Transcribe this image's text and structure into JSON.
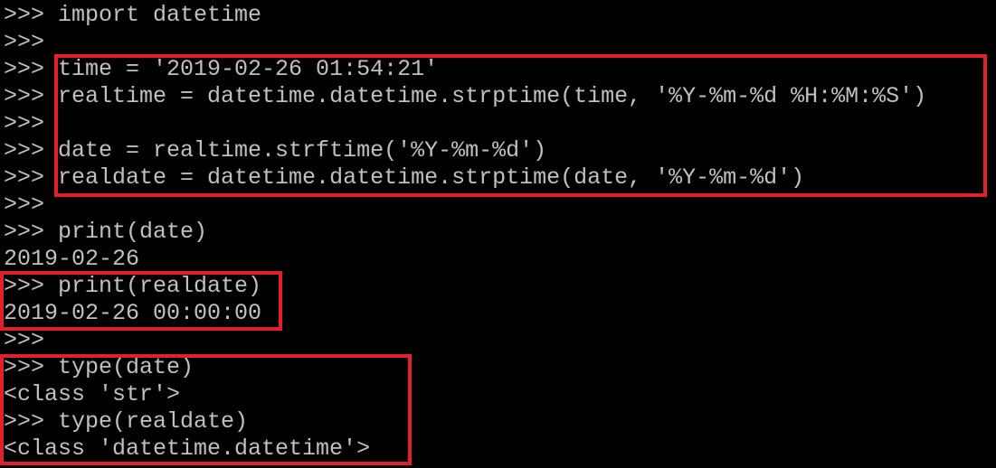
{
  "terminal": {
    "prompt": ">>> ",
    "highlight_color": "#e0212b",
    "text_color": "#c0c0c0",
    "background_color": "#000000",
    "lines": [
      {
        "kind": "input",
        "text": "import datetime"
      },
      {
        "kind": "input",
        "text": ""
      },
      {
        "kind": "input",
        "text": "time = '2019-02-26 01:54:21'"
      },
      {
        "kind": "input",
        "text": "realtime = datetime.datetime.strptime(time, '%Y-%m-%d %H:%M:%S')"
      },
      {
        "kind": "input",
        "text": ""
      },
      {
        "kind": "input",
        "text": "date = realtime.strftime('%Y-%m-%d')"
      },
      {
        "kind": "input",
        "text": "realdate = datetime.datetime.strptime(date, '%Y-%m-%d')"
      },
      {
        "kind": "input",
        "text": ""
      },
      {
        "kind": "input",
        "text": "print(date)"
      },
      {
        "kind": "output",
        "text": "2019-02-26"
      },
      {
        "kind": "input",
        "text": "print(realdate)"
      },
      {
        "kind": "output",
        "text": "2019-02-26 00:00:00"
      },
      {
        "kind": "input",
        "text": ""
      },
      {
        "kind": "input",
        "text": "type(date)"
      },
      {
        "kind": "output",
        "text": "<class 'str'>"
      },
      {
        "kind": "input",
        "text": "type(realdate)"
      },
      {
        "kind": "output",
        "text": "<class 'datetime.datetime'>"
      }
    ]
  }
}
